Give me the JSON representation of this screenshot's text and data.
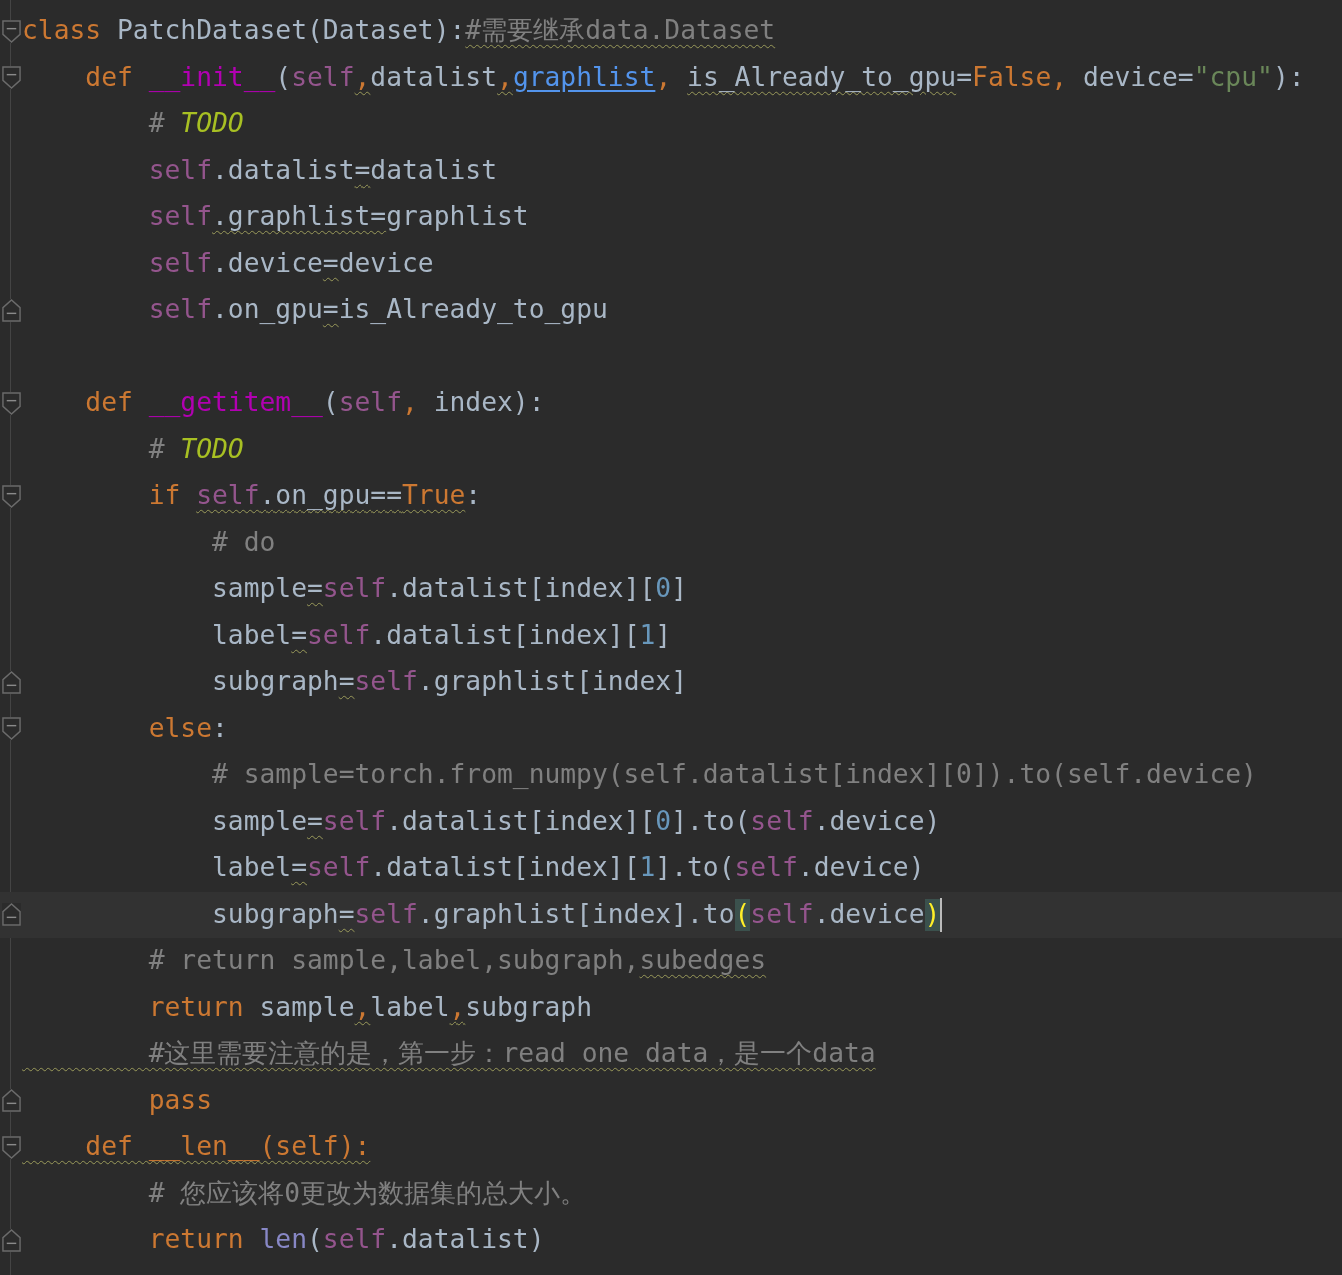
{
  "editor": {
    "lines": [
      {
        "fold_start": true,
        "fold_end": false,
        "current": false,
        "tokens": [
          {
            "kind": "kw",
            "text": "class"
          },
          {
            "kind": "plain",
            "text": " PatchDataset(Dataset):"
          },
          {
            "kind": "comment",
            "text": "#需要继承data.Dataset",
            "warning": true
          }
        ]
      },
      {
        "fold_start": true,
        "fold_end": false,
        "current": false,
        "tokens": [
          {
            "kind": "kw",
            "text": "    def"
          },
          {
            "kind": "magic",
            "text": " __init__"
          },
          {
            "kind": "plain",
            "text": "("
          },
          {
            "kind": "self",
            "text": "self"
          },
          {
            "kind": "kw",
            "text": ",",
            "warning": true
          },
          {
            "kind": "plain",
            "text": "datalist"
          },
          {
            "kind": "kw",
            "text": ",",
            "warning": true
          },
          {
            "kind": "param",
            "text": "graphlist"
          },
          {
            "kind": "kw",
            "text": ", "
          },
          {
            "kind": "plain",
            "text": "is_Already_to_gpu",
            "warning": true
          },
          {
            "kind": "plain",
            "text": "="
          },
          {
            "kind": "kw",
            "text": "False, "
          },
          {
            "kind": "plain",
            "text": "device="
          },
          {
            "kind": "str",
            "text": "\"cpu\""
          },
          {
            "kind": "plain",
            "text": "):"
          }
        ]
      },
      {
        "fold_start": false,
        "fold_end": false,
        "current": false,
        "tokens": [
          {
            "kind": "comment",
            "text": "        # "
          },
          {
            "kind": "todo",
            "text": "TODO"
          }
        ]
      },
      {
        "fold_start": false,
        "fold_end": false,
        "current": false,
        "tokens": [
          {
            "kind": "self",
            "text": "        self"
          },
          {
            "kind": "plain",
            "text": ".datalist"
          },
          {
            "kind": "plain",
            "text": "=",
            "warning": true
          },
          {
            "kind": "plain",
            "text": "datalist"
          }
        ]
      },
      {
        "fold_start": false,
        "fold_end": false,
        "current": false,
        "tokens": [
          {
            "kind": "self",
            "text": "        self"
          },
          {
            "kind": "plain",
            "text": ".graphlist=",
            "warning": true
          },
          {
            "kind": "plain",
            "text": "graphlist"
          }
        ]
      },
      {
        "fold_start": false,
        "fold_end": false,
        "current": false,
        "tokens": [
          {
            "kind": "self",
            "text": "        self"
          },
          {
            "kind": "plain",
            "text": ".device"
          },
          {
            "kind": "plain",
            "text": "=",
            "warning": true
          },
          {
            "kind": "plain",
            "text": "device"
          }
        ]
      },
      {
        "fold_start": false,
        "fold_end": true,
        "current": false,
        "tokens": [
          {
            "kind": "self",
            "text": "        self"
          },
          {
            "kind": "plain",
            "text": ".on_gpu"
          },
          {
            "kind": "plain",
            "text": "=",
            "warning": true
          },
          {
            "kind": "plain",
            "text": "is_Already_to_gpu"
          }
        ]
      },
      {
        "fold_start": false,
        "fold_end": false,
        "current": false
      },
      {
        "fold_start": true,
        "fold_end": false,
        "current": false,
        "tokens": [
          {
            "kind": "kw",
            "text": "    def"
          },
          {
            "kind": "magic",
            "text": " __getitem__"
          },
          {
            "kind": "plain",
            "text": "("
          },
          {
            "kind": "self",
            "text": "self"
          },
          {
            "kind": "kw",
            "text": ", "
          },
          {
            "kind": "plain",
            "text": "index):"
          }
        ]
      },
      {
        "fold_start": false,
        "fold_end": false,
        "current": false,
        "tokens": [
          {
            "kind": "comment",
            "text": "        # "
          },
          {
            "kind": "todo",
            "text": "TODO"
          }
        ]
      },
      {
        "fold_start": true,
        "fold_end": false,
        "current": false,
        "tokens": [
          {
            "kind": "kw",
            "text": "        if "
          },
          {
            "kind": "self",
            "text": "self",
            "warning": true
          },
          {
            "kind": "plain",
            "text": ".on_gpu==",
            "warning": true
          },
          {
            "kind": "kw",
            "text": "True",
            "warning": true
          },
          {
            "kind": "plain",
            "text": ":"
          }
        ]
      },
      {
        "fold_start": false,
        "fold_end": false,
        "current": false,
        "tokens": [
          {
            "kind": "comment",
            "text": "            # do"
          }
        ]
      },
      {
        "fold_start": false,
        "fold_end": false,
        "current": false,
        "tokens": [
          {
            "kind": "plain",
            "text": "            sample"
          },
          {
            "kind": "plain",
            "text": "=",
            "warning": true
          },
          {
            "kind": "self",
            "text": "self"
          },
          {
            "kind": "plain",
            "text": ".datalist[index]["
          },
          {
            "kind": "num",
            "text": "0"
          },
          {
            "kind": "plain",
            "text": "]"
          }
        ]
      },
      {
        "fold_start": false,
        "fold_end": false,
        "current": false,
        "tokens": [
          {
            "kind": "plain",
            "text": "            label"
          },
          {
            "kind": "plain",
            "text": "=",
            "warning": true
          },
          {
            "kind": "self",
            "text": "self"
          },
          {
            "kind": "plain",
            "text": ".datalist[index]["
          },
          {
            "kind": "num",
            "text": "1"
          },
          {
            "kind": "plain",
            "text": "]"
          }
        ]
      },
      {
        "fold_start": false,
        "fold_end": true,
        "current": false,
        "tokens": [
          {
            "kind": "plain",
            "text": "            subgraph"
          },
          {
            "kind": "plain",
            "text": "=",
            "warning": true
          },
          {
            "kind": "self",
            "text": "self"
          },
          {
            "kind": "plain",
            "text": ".graphlist[index]"
          }
        ]
      },
      {
        "fold_start": true,
        "fold_end": false,
        "current": false,
        "tokens": [
          {
            "kind": "kw",
            "text": "        else"
          },
          {
            "kind": "plain",
            "text": ":"
          }
        ]
      },
      {
        "fold_start": false,
        "fold_end": false,
        "current": false,
        "tokens": [
          {
            "kind": "comment",
            "text": "            # sample=torch.from_numpy(self.datalist[index][0]).to(self.device)"
          }
        ]
      },
      {
        "fold_start": false,
        "fold_end": false,
        "current": false,
        "tokens": [
          {
            "kind": "plain",
            "text": "            sample"
          },
          {
            "kind": "plain",
            "text": "=",
            "warning": true
          },
          {
            "kind": "self",
            "text": "self"
          },
          {
            "kind": "plain",
            "text": ".datalist[index]["
          },
          {
            "kind": "num",
            "text": "0"
          },
          {
            "kind": "plain",
            "text": "].to("
          },
          {
            "kind": "self",
            "text": "self"
          },
          {
            "kind": "plain",
            "text": ".device)"
          }
        ]
      },
      {
        "fold_start": false,
        "fold_end": false,
        "current": false,
        "tokens": [
          {
            "kind": "plain",
            "text": "            label"
          },
          {
            "kind": "plain",
            "text": "=",
            "warning": true
          },
          {
            "kind": "self",
            "text": "self"
          },
          {
            "kind": "plain",
            "text": ".datalist[index]["
          },
          {
            "kind": "num",
            "text": "1"
          },
          {
            "kind": "plain",
            "text": "].to("
          },
          {
            "kind": "self",
            "text": "self"
          },
          {
            "kind": "plain",
            "text": ".device)"
          }
        ]
      },
      {
        "fold_start": false,
        "fold_end": true,
        "current": true,
        "tokens": [
          {
            "kind": "plain",
            "text": "            subgraph"
          },
          {
            "kind": "plain",
            "text": "=",
            "warning": true
          },
          {
            "kind": "self",
            "text": "self"
          },
          {
            "kind": "plain",
            "text": ".graphlist[index].to"
          },
          {
            "kind": "brace",
            "text": "("
          },
          {
            "kind": "self",
            "text": "self"
          },
          {
            "kind": "plain",
            "text": ".device"
          },
          {
            "kind": "brace",
            "text": ")"
          }
        ]
      },
      {
        "fold_start": false,
        "fold_end": false,
        "current": false,
        "tokens": [
          {
            "kind": "comment",
            "text": "        # return sample,label,subgraph,"
          },
          {
            "kind": "comment",
            "text": "subedges",
            "warning": true
          }
        ]
      },
      {
        "fold_start": false,
        "fold_end": false,
        "current": false,
        "tokens": [
          {
            "kind": "kw",
            "text": "        return"
          },
          {
            "kind": "plain",
            "text": " sample"
          },
          {
            "kind": "kw",
            "text": ",",
            "warning": true
          },
          {
            "kind": "plain",
            "text": "label"
          },
          {
            "kind": "kw",
            "text": ",",
            "warning": true
          },
          {
            "kind": "plain",
            "text": "subgraph"
          }
        ]
      },
      {
        "fold_start": false,
        "fold_end": false,
        "current": false,
        "tokens": [
          {
            "kind": "comment",
            "text": "        #这里需要注意的是，第一步：read one data，是一个data",
            "warning": true
          }
        ]
      },
      {
        "fold_start": false,
        "fold_end": true,
        "current": false,
        "tokens": [
          {
            "kind": "kw",
            "text": "        pass"
          }
        ]
      },
      {
        "fold_start": true,
        "fold_end": false,
        "current": false,
        "tokens": [
          {
            "kind": "kw",
            "text": "    def __len__(self):",
            "warning": true
          }
        ]
      },
      {
        "fold_start": false,
        "fold_end": false,
        "current": false,
        "tokens": [
          {
            "kind": "comment",
            "text": "        # 您应该将0更改为数据集的总大小。"
          }
        ]
      },
      {
        "fold_start": false,
        "fold_end": true,
        "current": false,
        "tokens": [
          {
            "kind": "kw",
            "text": "        return"
          },
          {
            "kind": "builtin",
            "text": " len"
          },
          {
            "kind": "plain",
            "text": "("
          },
          {
            "kind": "self",
            "text": "self"
          },
          {
            "kind": "plain",
            "text": ".datalist)"
          }
        ]
      }
    ]
  }
}
